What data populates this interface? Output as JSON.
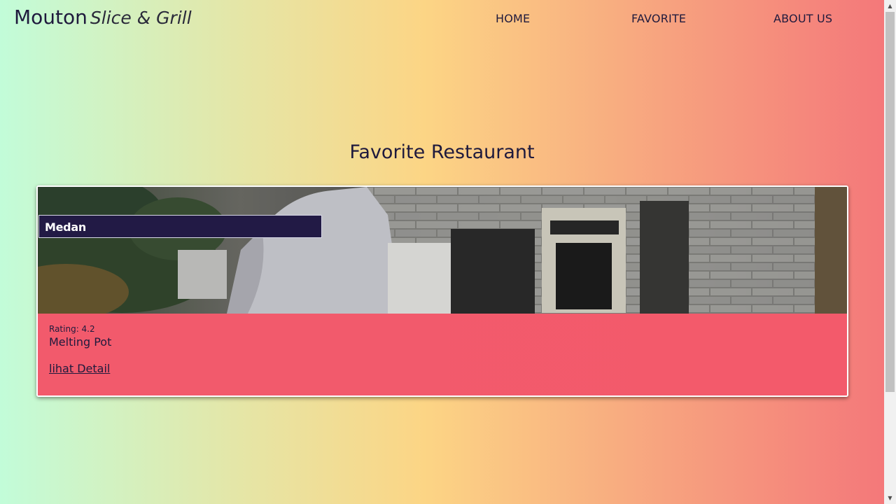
{
  "header": {
    "brand_name": "Mouton",
    "brand_sub": "Slice & Grill"
  },
  "nav": {
    "home": "HOME",
    "favorite": "FAVORITE",
    "about": "ABOUT US"
  },
  "main": {
    "title": "Favorite Restaurant",
    "cards": [
      {
        "city": "Medan",
        "rating_label": "Rating: 4.2",
        "name": "Melting Pot",
        "detail_link": "lihat Detail"
      }
    ]
  },
  "colors": {
    "card_body": "#f25a6a",
    "badge_bg": "#221a45",
    "text_dark": "#1f1a3d"
  },
  "icons": {
    "scroll_up": "arrow-up-icon",
    "scroll_down": "arrow-down-icon"
  }
}
